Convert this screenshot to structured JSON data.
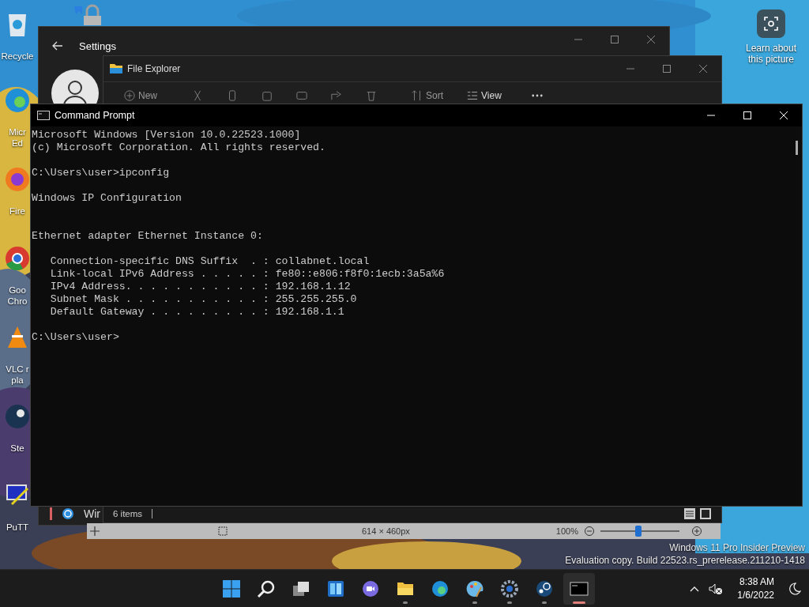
{
  "desktop": {
    "icons": [
      {
        "kind": "recycle-bin",
        "label": [
          "Recycle"
        ]
      },
      {
        "kind": "edge",
        "label": [
          "Micr",
          "Ed"
        ]
      },
      {
        "kind": "firefox",
        "label": [
          "Fire"
        ]
      },
      {
        "kind": "chrome",
        "label": [
          "Goo",
          "Chro"
        ]
      },
      {
        "kind": "vlc",
        "label": [
          "VLC r",
          "pla"
        ]
      },
      {
        "kind": "steam",
        "label": [
          "Ste"
        ]
      },
      {
        "kind": "putty",
        "label": [
          "PuTT"
        ]
      }
    ],
    "spotlight": {
      "label": "Learn about this picture"
    },
    "watermark": [
      "Windows 11 Pro Insider Preview",
      "Evaluation copy. Build 22523.rs_prerelease.211210-1418"
    ]
  },
  "settings_window": {
    "title": "Settings",
    "sidebar_items": [
      {
        "label": "Wir",
        "selected": true
      }
    ]
  },
  "file_explorer": {
    "title": "File Explorer",
    "toolbar": [
      {
        "kind": "new",
        "label": "New"
      },
      {
        "kind": "cut"
      },
      {
        "kind": "copy"
      },
      {
        "kind": "paste"
      },
      {
        "kind": "rename"
      },
      {
        "kind": "share"
      },
      {
        "kind": "delete"
      },
      {
        "kind": "sort",
        "label": "Sort"
      },
      {
        "kind": "view",
        "label": "View"
      },
      {
        "kind": "more"
      }
    ],
    "status_bar": {
      "item_count": "6 items"
    }
  },
  "image_viewer_status": {
    "image_size": "614 × 460px",
    "zoom": "100%",
    "zoom_slider": {
      "level": 0.48
    }
  },
  "command_prompt": {
    "title": "Command Prompt",
    "output": "Microsoft Windows [Version 10.0.22523.1000]\n(c) Microsoft Corporation. All rights reserved.\n\nC:\\Users\\user>ipconfig\n\nWindows IP Configuration\n\n\nEthernet adapter Ethernet Instance 0:\n\n   Connection-specific DNS Suffix  . : collabnet.local\n   Link-local IPv6 Address . . . . . : fe80::e806:f8f0:1ecb:3a5a%6\n   IPv4 Address. . . . . . . . . . . : 192.168.1.12\n   Subnet Mask . . . . . . . . . . . : 255.255.255.0\n   Default Gateway . . . . . . . . . : 192.168.1.1\n\nC:\\Users\\user>"
  },
  "taskbar": {
    "apps": [
      {
        "kind": "start",
        "running": false,
        "active": false
      },
      {
        "kind": "search",
        "running": false,
        "active": false
      },
      {
        "kind": "task-view",
        "running": false,
        "active": false
      },
      {
        "kind": "widgets",
        "running": false,
        "active": false
      },
      {
        "kind": "chat",
        "running": false,
        "active": false
      },
      {
        "kind": "file-explorer",
        "running": true,
        "active": false
      },
      {
        "kind": "edge",
        "running": false,
        "active": false
      },
      {
        "kind": "paint",
        "running": true,
        "active": false
      },
      {
        "kind": "settings",
        "running": true,
        "active": false
      },
      {
        "kind": "steam",
        "running": true,
        "active": false
      },
      {
        "kind": "terminal",
        "running": true,
        "active": true
      }
    ],
    "clock": {
      "time": "8:38 AM",
      "date": "1/6/2022"
    }
  }
}
